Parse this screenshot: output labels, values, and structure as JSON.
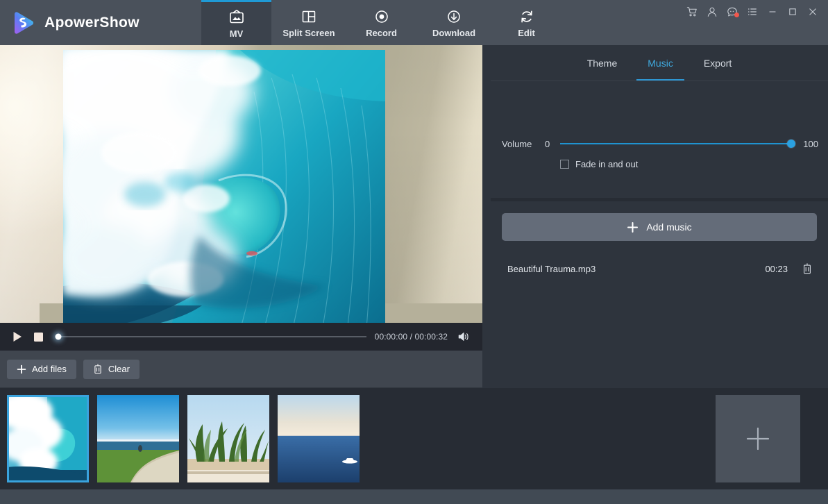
{
  "app": {
    "name": "ApowerShow",
    "logo_icon": "apowershow-logo-icon",
    "accent_color": "#2e96d2",
    "titlebar_color": "#4a515b",
    "panel_color": "#2e343d"
  },
  "nav": {
    "tabs": [
      {
        "label": "MV",
        "icon": "tv-icon",
        "active": true
      },
      {
        "label": "Split Screen",
        "icon": "split-screen-icon",
        "active": false
      },
      {
        "label": "Record",
        "icon": "record-icon",
        "active": false
      },
      {
        "label": "Download",
        "icon": "download-icon",
        "active": false
      },
      {
        "label": "Edit",
        "icon": "refresh-edit-icon",
        "active": false
      }
    ]
  },
  "window_controls": [
    {
      "name": "cart-icon",
      "title": "Store"
    },
    {
      "name": "user-icon",
      "title": "Account"
    },
    {
      "name": "message-icon",
      "title": "Messages",
      "badge": true
    },
    {
      "name": "menu-list-icon",
      "title": "Menu"
    },
    {
      "name": "minimize-icon",
      "title": "Minimize"
    },
    {
      "name": "maximize-icon",
      "title": "Maximize"
    },
    {
      "name": "close-icon",
      "title": "Close"
    }
  ],
  "player": {
    "play_icon": "play-icon",
    "stop_icon": "stop-icon",
    "volume_icon": "speaker-icon",
    "current_time": "00:00:00",
    "total_time": "00:00:32",
    "time_display": "00:00:00 / 00:00:32",
    "progress_percent": 0
  },
  "file_toolbar": {
    "add_files_label": "Add files",
    "add_files_icon": "plus-icon",
    "clear_label": "Clear",
    "clear_icon": "trash-icon"
  },
  "timeline": {
    "add_thumb_icon": "plus-icon",
    "thumbs": [
      {
        "name": "thumb-wave",
        "selected": true
      },
      {
        "name": "thumb-coastal-path",
        "selected": false
      },
      {
        "name": "thumb-banana-plants",
        "selected": false
      },
      {
        "name": "thumb-sea-boat",
        "selected": false
      }
    ]
  },
  "right_panel": {
    "tabs": [
      {
        "label": "Theme",
        "active": false
      },
      {
        "label": "Music",
        "active": true
      },
      {
        "label": "Export",
        "active": false
      }
    ],
    "volume": {
      "label": "Volume",
      "min": "0",
      "max": "100",
      "value": 100
    },
    "fade": {
      "label": "Fade in and out",
      "checked": false
    },
    "add_music": {
      "label": "Add music",
      "icon": "plus-icon"
    },
    "music_list": [
      {
        "name": "Beautiful Trauma.mp3",
        "duration": "00:23",
        "delete_icon": "trash-icon"
      }
    ]
  }
}
